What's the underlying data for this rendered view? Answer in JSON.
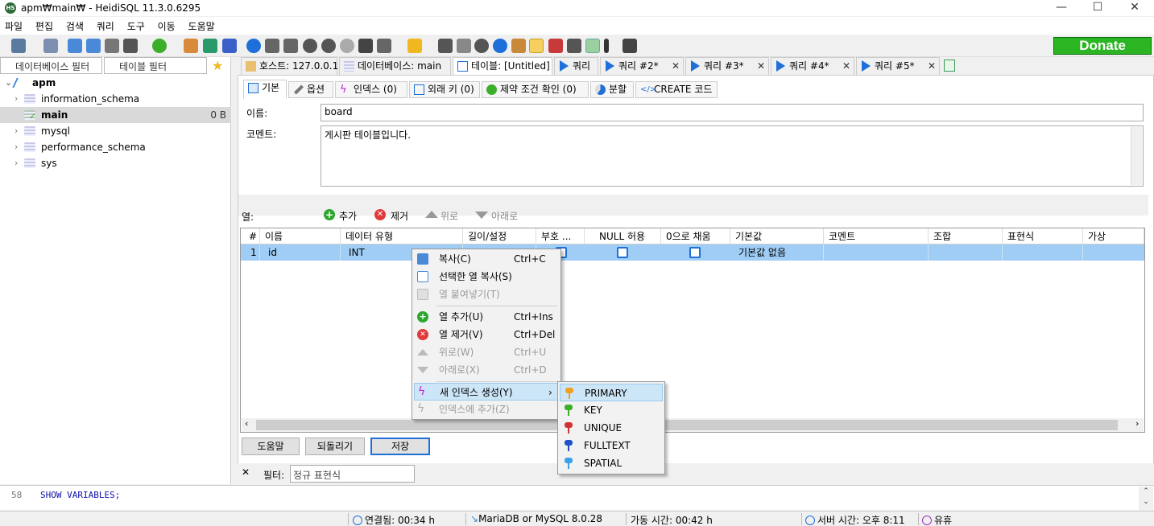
{
  "window": {
    "title": "apm₩main₩ - HeidiSQL 11.3.0.6295",
    "app_icon": "HS",
    "minimize": "—",
    "maximize": "☐",
    "close": "✕"
  },
  "menubar": [
    "파일",
    "편집",
    "검색",
    "쿼리",
    "도구",
    "이동",
    "도움말"
  ],
  "donate_label": "Donate",
  "colors": {
    "accent": "#1e6fd9",
    "donate": "#2bb522",
    "row_selected": "#9fcdf5",
    "menu_highlight": "#cde6f7"
  },
  "left": {
    "db_filter_placeholder": "데이터베이스 필터",
    "table_filter_placeholder": "테이블 필터",
    "root": "apm",
    "items": [
      {
        "label": "information_schema",
        "size": ""
      },
      {
        "label": "main",
        "size": "0 B"
      },
      {
        "label": "mysql",
        "size": ""
      },
      {
        "label": "performance_schema",
        "size": ""
      },
      {
        "label": "sys",
        "size": ""
      }
    ]
  },
  "tabs": {
    "host": "호스트: 127.0.0.1",
    "database": "데이터베이스: main",
    "table": "테이블: [Untitled]",
    "query1": "쿼리",
    "query2": "쿼리 #2*",
    "query3": "쿼리 #3*",
    "query4": "쿼리 #4*",
    "query5": "쿼리 #5*"
  },
  "subtabs": {
    "basic": "기본",
    "options": "옵션",
    "indexes": "인덱스 (0)",
    "foreign": "외래 키 (0)",
    "checks": "제약 조건 확인 (0)",
    "partition": "분할",
    "create": "CREATE 코드"
  },
  "form": {
    "name_label": "이름:",
    "name_value": "board",
    "comment_label": "코멘트:",
    "comment_value": "게시판 테이블입니다."
  },
  "columns_toolbar": {
    "label": "열:",
    "add": "추가",
    "remove": "제거",
    "up": "위로",
    "down": "아래로"
  },
  "grid": {
    "headers": [
      "#",
      "이름",
      "데이터 유형",
      "길이/설정",
      "부호 ...",
      "NULL 허용",
      "0으로 채움",
      "기본값",
      "코멘트",
      "조합",
      "표현식",
      "가상"
    ],
    "rows": [
      {
        "num": "1",
        "name": "id",
        "type": "INT",
        "length": "",
        "default": "기본값 없음"
      }
    ]
  },
  "buttons": {
    "help": "도움말",
    "revert": "되돌리기",
    "save": "저장"
  },
  "context_menu": [
    {
      "label": "복사(C)",
      "shortcut": "Ctrl+C",
      "icon": "copy-icon",
      "disabled": false
    },
    {
      "label": "선택한 열 복사(S)",
      "shortcut": "",
      "icon": "copy-columns-icon",
      "disabled": false
    },
    {
      "label": "열 붙여넣기(T)",
      "shortcut": "",
      "icon": "paste-icon",
      "disabled": true
    },
    {
      "label": "열 추가(U)",
      "shortcut": "Ctrl+Ins",
      "icon": "add-icon",
      "disabled": false
    },
    {
      "label": "열 제거(V)",
      "shortcut": "Ctrl+Del",
      "icon": "remove-icon",
      "disabled": false
    },
    {
      "label": "위로(W)",
      "shortcut": "Ctrl+U",
      "icon": "up-icon",
      "disabled": true
    },
    {
      "label": "아래로(X)",
      "shortcut": "Ctrl+D",
      "icon": "down-icon",
      "disabled": true
    },
    {
      "label": "새 인덱스 생성(Y)",
      "shortcut": "",
      "icon": "lightning-icon",
      "disabled": false
    },
    {
      "label": "인덱스에 추가(Z)",
      "shortcut": "",
      "icon": "lightning-icon",
      "disabled": true
    }
  ],
  "submenu": [
    {
      "label": "PRIMARY",
      "color": "#f0a020"
    },
    {
      "label": "KEY",
      "color": "#3cae2a"
    },
    {
      "label": "UNIQUE",
      "color": "#d23232"
    },
    {
      "label": "FULLTEXT",
      "color": "#1e50c8"
    },
    {
      "label": "SPATIAL",
      "color": "#3aa0e8"
    }
  ],
  "filter": {
    "close": "✕",
    "label": "필터:",
    "placeholder": "정규 표현식"
  },
  "sqllog": {
    "line": "58",
    "code": "SHOW VARIABLES;"
  },
  "status": {
    "connected": "연결됨: 00:34 h",
    "server": "MariaDB or MySQL 8.0.28",
    "uptime": "가동 시간: 00:42 h",
    "server_time": "서버 시간: 오후 8:11",
    "idle": "유휴"
  }
}
